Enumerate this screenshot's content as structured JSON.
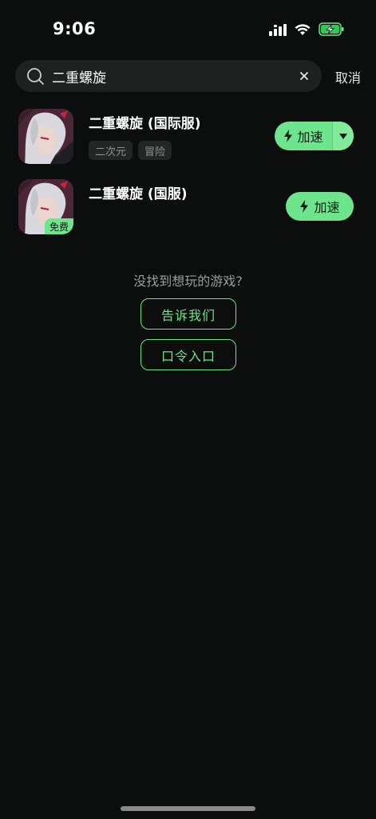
{
  "status": {
    "time": "9:06"
  },
  "search": {
    "query": "二重螺旋",
    "cancel_label": "取消"
  },
  "results": [
    {
      "title": "二重螺旋 (国际服)",
      "tags": [
        "二次元",
        "冒险"
      ],
      "button_label": "加速"
    },
    {
      "title": "二重螺旋 (国服)",
      "badge": "免费",
      "button_label": "加速"
    }
  ],
  "feedback": {
    "hint": "没找到想玩的游戏?",
    "tell_us_label": "告诉我们",
    "password_entry_label": "口令入口"
  },
  "colors": {
    "accent": "#6ee58c",
    "background": "#0c0d0d",
    "field": "#1f2020"
  }
}
